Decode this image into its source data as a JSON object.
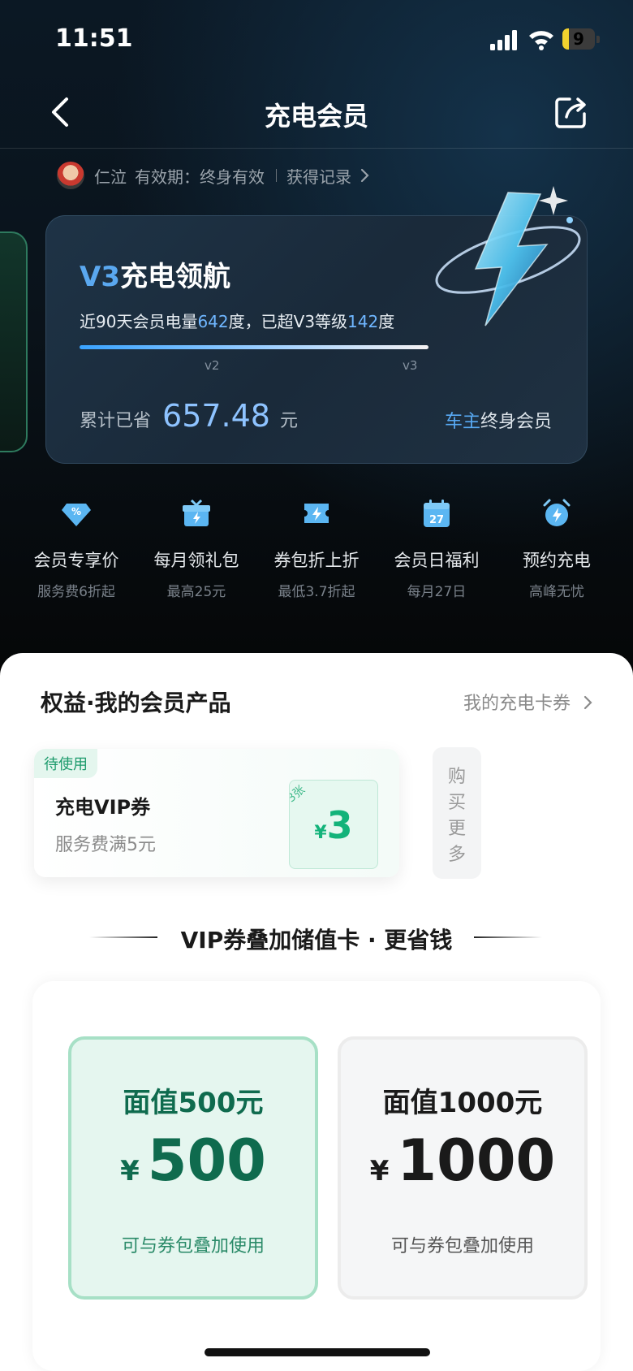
{
  "status_bar": {
    "time": "11:51",
    "battery": "9",
    "battery_level": 0.09,
    "battery_color": "#f2d22e"
  },
  "nav": {
    "title": "充电会员"
  },
  "user": {
    "name": "仁泣",
    "validity": "有效期：终身有效",
    "records_link": "获得记录"
  },
  "member_card": {
    "level_prefix": "V3",
    "level_name": "充电领航",
    "progress_text_1": "近90天会员电量",
    "kwh_90d": "642",
    "progress_text_2": "度，已超V3等级",
    "kwh_over": "142",
    "progress_text_3": "度",
    "marker_v2": "v2",
    "marker_v3": "v3",
    "saved_label": "累计已省",
    "saved_amount": "657.48",
    "saved_unit": "元",
    "owner_prefix": "车主",
    "owner_suffix": "终身会员"
  },
  "benefits": [
    {
      "icon": "percent-diamond-icon",
      "title": "会员专享价",
      "sub": "服务费6折起"
    },
    {
      "icon": "gift-bolt-icon",
      "title": "每月领礼包",
      "sub": "最高25元"
    },
    {
      "icon": "coupon-bolt-icon",
      "title": "券包折上折",
      "sub": "最低3.7折起"
    },
    {
      "icon": "calendar-27-icon",
      "title": "会员日福利",
      "sub": "每月27日"
    },
    {
      "icon": "alarm-bolt-icon",
      "title": "预约充电",
      "sub": "高峰无忧"
    }
  ],
  "calendar_day": "27",
  "products": {
    "title": "权益·我的会员产品",
    "link": "我的充电卡券",
    "coupon": {
      "tag": "待使用",
      "name": "充电VIP券",
      "condition": "服务费满5元",
      "count": "3张",
      "currency": "¥",
      "amount": "3"
    },
    "buy_more": [
      "购",
      "买",
      "更",
      "多"
    ]
  },
  "promo": {
    "text": "VIP券叠加储值卡 · 更省钱"
  },
  "stored_cards": [
    {
      "face": "面值500元",
      "currency": "¥",
      "price": "500",
      "note": "可与券包叠加使用"
    },
    {
      "face": "面值1000元",
      "currency": "¥",
      "price": "1000",
      "note": "可与券包叠加使用"
    }
  ],
  "colors": {
    "accent_green": "#13b37a",
    "accent_blue": "#5aa8f0"
  }
}
